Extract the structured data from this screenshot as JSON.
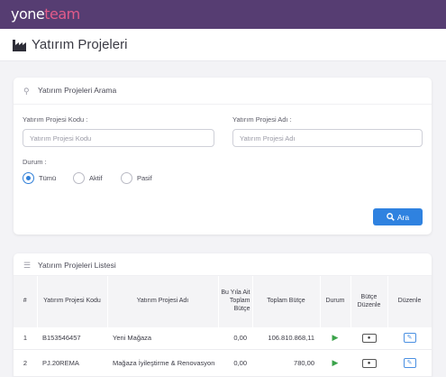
{
  "app": {
    "logo_main": "yone",
    "logo_accent": "team",
    "accent_color": "#e25b8a",
    "topbar_color": "#563d72"
  },
  "page": {
    "title": "Yatırım Projeleri",
    "title_icon": "factory-icon"
  },
  "search": {
    "header": "Yatırım Projeleri Arama",
    "header_icon": "search-icon",
    "code_label": "Yatırım Projesi Kodu :",
    "code_placeholder": "Yatırım Projesi Kodu",
    "code_value": "",
    "name_label": "Yatırım Projesi Adı :",
    "name_placeholder": "Yatırım Projesi Adı",
    "name_value": "",
    "status_label": "Durum :",
    "status_options": [
      {
        "label": "Tümü",
        "selected": true
      },
      {
        "label": "Aktif",
        "selected": false
      },
      {
        "label": "Pasif",
        "selected": false
      }
    ],
    "search_button": "Ara",
    "search_button_icon": "search-icon",
    "button_color": "#2f82e0"
  },
  "list": {
    "header": "Yatırım Projeleri Listesi",
    "header_icon": "list-icon",
    "columns": [
      "#",
      "Yatırım Projesi Kodu",
      "Yatırım Projesi Adı",
      "Bu Yıla Ait Toplam Bütçe",
      "Toplam Bütçe",
      "Durum",
      "Bütçe Düzenle",
      "Düzenle"
    ],
    "rows": [
      {
        "no": "1",
        "code": "B153546457",
        "name": "Yeni Mağaza",
        "year_budget": "0,00",
        "total_budget": "106.810.868,11",
        "status_icon": "play-icon",
        "budget_edit_icon": "money-icon",
        "edit_icon": "edit-icon"
      },
      {
        "no": "2",
        "code": "PJ.20REMA",
        "name": "Mağaza İyileştirme & Renovasyon",
        "year_budget": "0,00",
        "total_budget": "780,00",
        "status_icon": "play-icon",
        "budget_edit_icon": "money-icon",
        "edit_icon": "edit-icon"
      }
    ]
  }
}
